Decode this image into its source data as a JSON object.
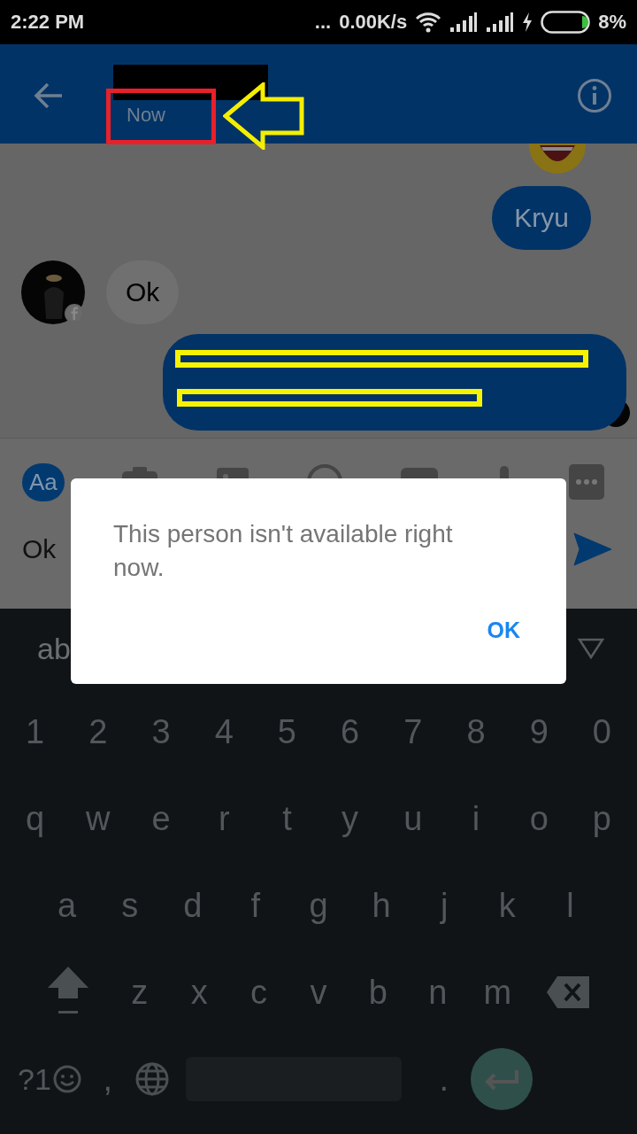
{
  "status_bar": {
    "time": "2:22 PM",
    "activity": "...",
    "speed": "0.00K/s",
    "battery": "8%"
  },
  "header": {
    "status": "Now"
  },
  "messages": [
    {
      "kind": "sticker",
      "incoming": false
    },
    {
      "kind": "text",
      "incoming": false,
      "text": "Kryu"
    },
    {
      "kind": "text",
      "incoming": true,
      "text": "Ok"
    },
    {
      "kind": "redacted",
      "incoming": false
    }
  ],
  "composer": {
    "mode_label": "Aa",
    "value": "Ok"
  },
  "keyboard": {
    "suggestion": "ab",
    "rows": [
      [
        "1",
        "2",
        "3",
        "4",
        "5",
        "6",
        "7",
        "8",
        "9",
        "0"
      ],
      [
        "q",
        "w",
        "e",
        "r",
        "t",
        "y",
        "u",
        "i",
        "o",
        "p"
      ],
      [
        "a",
        "s",
        "d",
        "f",
        "g",
        "h",
        "j",
        "k",
        "l"
      ],
      [
        "z",
        "x",
        "c",
        "v",
        "b",
        "n",
        "m"
      ]
    ],
    "symbols_key": "?1",
    "comma_key": ",",
    "period_key": "."
  },
  "dialog": {
    "message": "This person isn't available right now.",
    "button": "OK"
  }
}
